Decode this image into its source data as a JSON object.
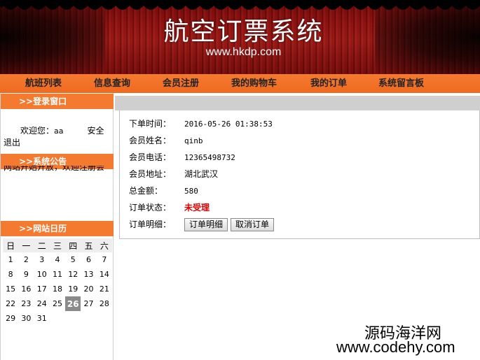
{
  "banner": {
    "title": "航空订票系统",
    "url": "www.hkdp.com"
  },
  "nav": {
    "items": [
      "航班列表",
      "信息查询",
      "会员注册",
      "我的购物车",
      "我的订单",
      "系统留言板"
    ]
  },
  "sidebar": {
    "login_header": ">>登录窗口",
    "welcome_prefix": "欢迎您：",
    "username": "aa",
    "logout_label": "安全退出",
    "notice_header": ">>系统公告",
    "notice_text": "网站开始开放，欢迎注册会员！",
    "calendar_header": ">>网站日历"
  },
  "calendar": {
    "weekdays": [
      "日",
      "一",
      "二",
      "三",
      "四",
      "五",
      "六"
    ],
    "today": "26",
    "weeks": [
      [
        "1",
        "2",
        "3",
        "4",
        "5",
        "6",
        "7"
      ],
      [
        "8",
        "9",
        "10",
        "11",
        "12",
        "13",
        "14"
      ],
      [
        "15",
        "16",
        "17",
        "18",
        "19",
        "20",
        "21"
      ],
      [
        "22",
        "23",
        "24",
        "25",
        "26",
        "27",
        "28"
      ],
      [
        "29",
        "30",
        "31",
        "",
        "",
        "",
        ""
      ]
    ]
  },
  "order": {
    "time_label": "下单时间：",
    "time_value": "2016-05-26 01:38:53",
    "name_label": "会员姓名：",
    "name_value": "qinb",
    "phone_label": "会员电话：",
    "phone_value": "12365498732",
    "address_label": "会员地址：",
    "address_value": "湖北武汉",
    "total_label": "总金额：",
    "total_value": "580",
    "status_label": "订单状态：",
    "status_value": "未受理",
    "detail_label": "订单明细：",
    "detail_button": "订单明细",
    "cancel_button": "取消订单"
  },
  "watermark": {
    "line1": "源码海洋网",
    "line2": "www.codehy.com"
  },
  "colors": {
    "nav_orange": "#f47a30",
    "status_red": "#e00000",
    "banner_red": "#9c1412"
  }
}
